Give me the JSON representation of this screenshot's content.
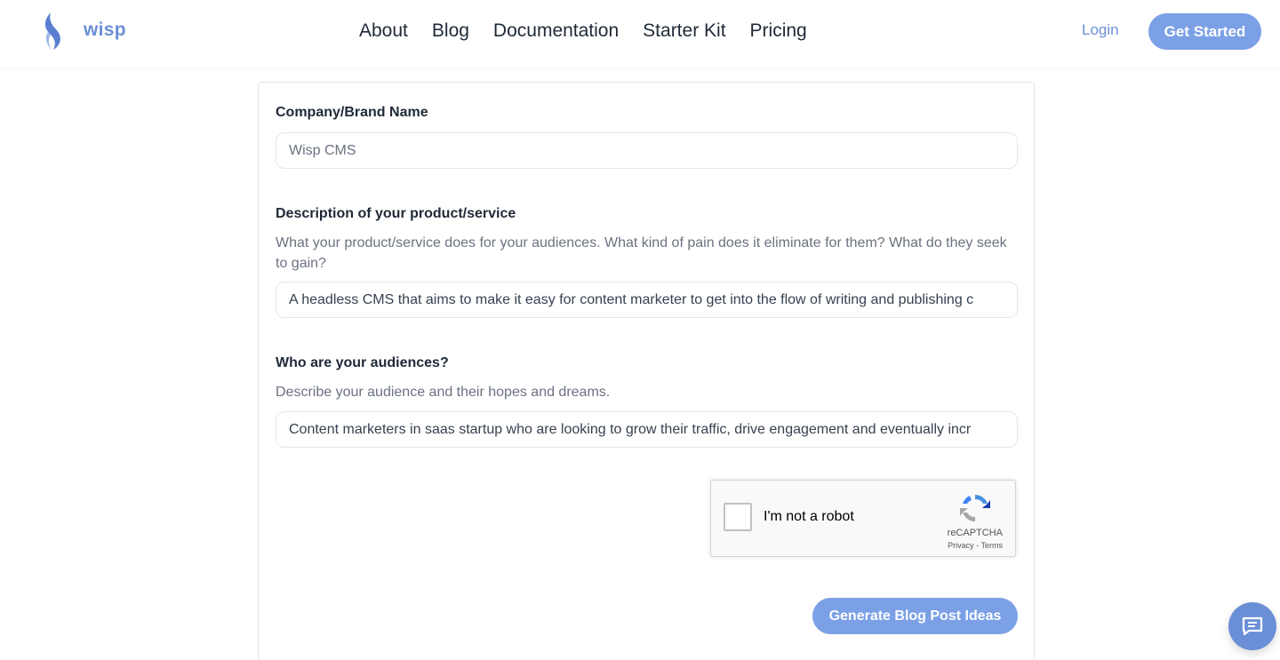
{
  "header": {
    "logo_text": "wisp",
    "nav": [
      {
        "label": "About"
      },
      {
        "label": "Blog"
      },
      {
        "label": "Documentation"
      },
      {
        "label": "Starter Kit"
      },
      {
        "label": "Pricing"
      }
    ],
    "login_label": "Login",
    "get_started_label": "Get Started"
  },
  "form": {
    "company": {
      "label": "Company/Brand Name",
      "placeholder": "Wisp CMS",
      "value": ""
    },
    "description": {
      "label": "Description of your product/service",
      "help": "What your product/service does for your audiences. What kind of pain does it eliminate for them? What do they seek to gain?",
      "value": "A headless CMS that aims to make it easy for content marketer to get into the flow of writing and publishing c"
    },
    "audience": {
      "label": "Who are your audiences?",
      "help": "Describe your audience and their hopes and dreams.",
      "value": "Content marketers in saas startup who are looking to grow their traffic, drive engagement and eventually incr"
    },
    "recaptcha": {
      "label": "I'm not a robot",
      "brand": "reCAPTCHA",
      "privacy": "Privacy",
      "separator": " - ",
      "terms": "Terms"
    },
    "submit_label": "Generate Blog Post Ideas"
  },
  "colors": {
    "accent": "#7ba0e6",
    "brand": "#6b8fd6"
  },
  "icons": {
    "logo": "wisp-flame-icon",
    "chat": "chat-icon",
    "recaptcha": "recaptcha-icon"
  }
}
